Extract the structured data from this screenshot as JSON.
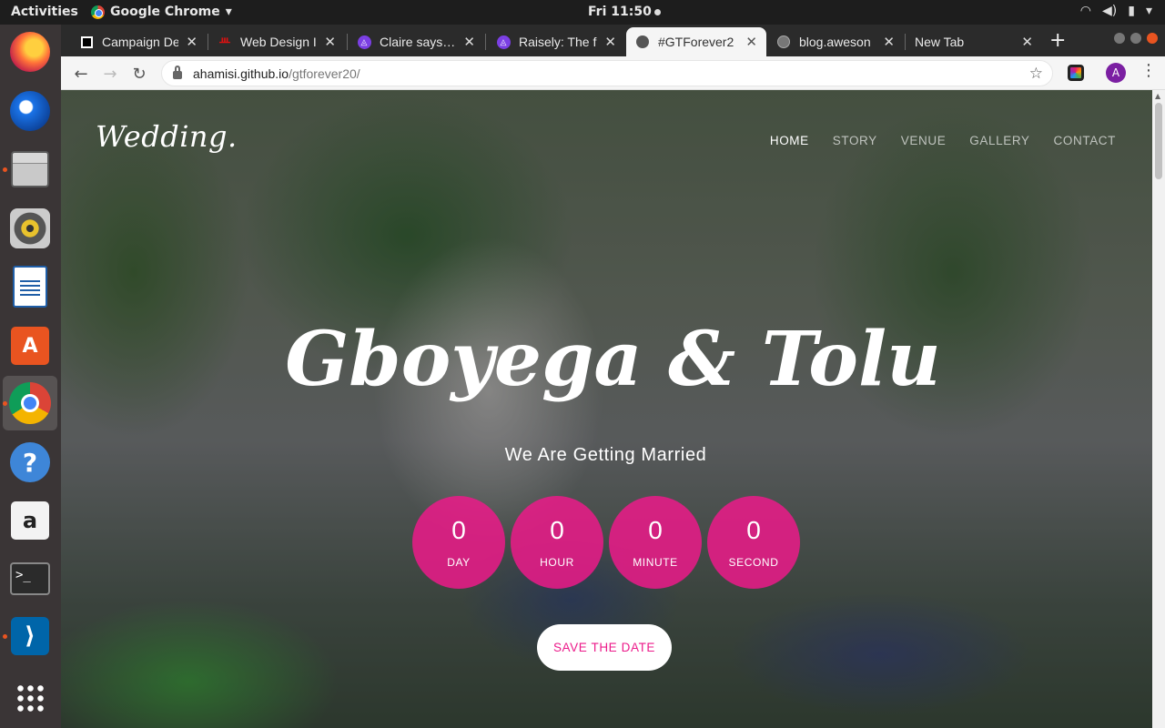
{
  "topbar": {
    "activities": "Activities",
    "app_name": "Google Chrome",
    "app_caret": "▾",
    "clock": "Fri 11:50",
    "tray": [
      "wifi-icon",
      "volume-icon",
      "battery-icon",
      "menu-caret"
    ]
  },
  "dock": {
    "apps": [
      "firefox",
      "thunderbird",
      "files",
      "rhythmbox",
      "libreoffice-writer",
      "ubuntu-software",
      "google-chrome",
      "help",
      "amazon",
      "terminal",
      "vscode",
      "show-applications"
    ]
  },
  "tabs": [
    {
      "title": "Campaign De",
      "favicon": "square-icon"
    },
    {
      "title": "Web Design I",
      "favicon": "red-logo-icon"
    },
    {
      "title": "Claire says…",
      "favicon": "raisely-icon"
    },
    {
      "title": "Raisely: The f",
      "favicon": "raisely-icon"
    },
    {
      "title": "#GTForever2",
      "favicon": "globe-icon",
      "active": true
    },
    {
      "title": "blog.aweson",
      "favicon": "globe-icon"
    },
    {
      "title": "New Tab",
      "favicon": ""
    }
  ],
  "new_tab_symbol": "+",
  "close_symbol": "✕",
  "address": {
    "host": "ahamisi.github.io",
    "path": "/gtforever20/"
  },
  "profile_initial": "A",
  "site": {
    "logo": "Wedding.",
    "nav": [
      "HOME",
      "STORY",
      "VENUE",
      "GALLERY",
      "CONTACT"
    ],
    "title": "Gboyega & Tolu",
    "subtitle": "We Are Getting Married",
    "countdown": [
      {
        "value": "0",
        "label": "DAY"
      },
      {
        "value": "0",
        "label": "HOUR"
      },
      {
        "value": "0",
        "label": "MINUTE"
      },
      {
        "value": "0",
        "label": "SECOND"
      }
    ],
    "cta": "SAVE THE DATE",
    "accent_color": "#ec1a8a"
  }
}
